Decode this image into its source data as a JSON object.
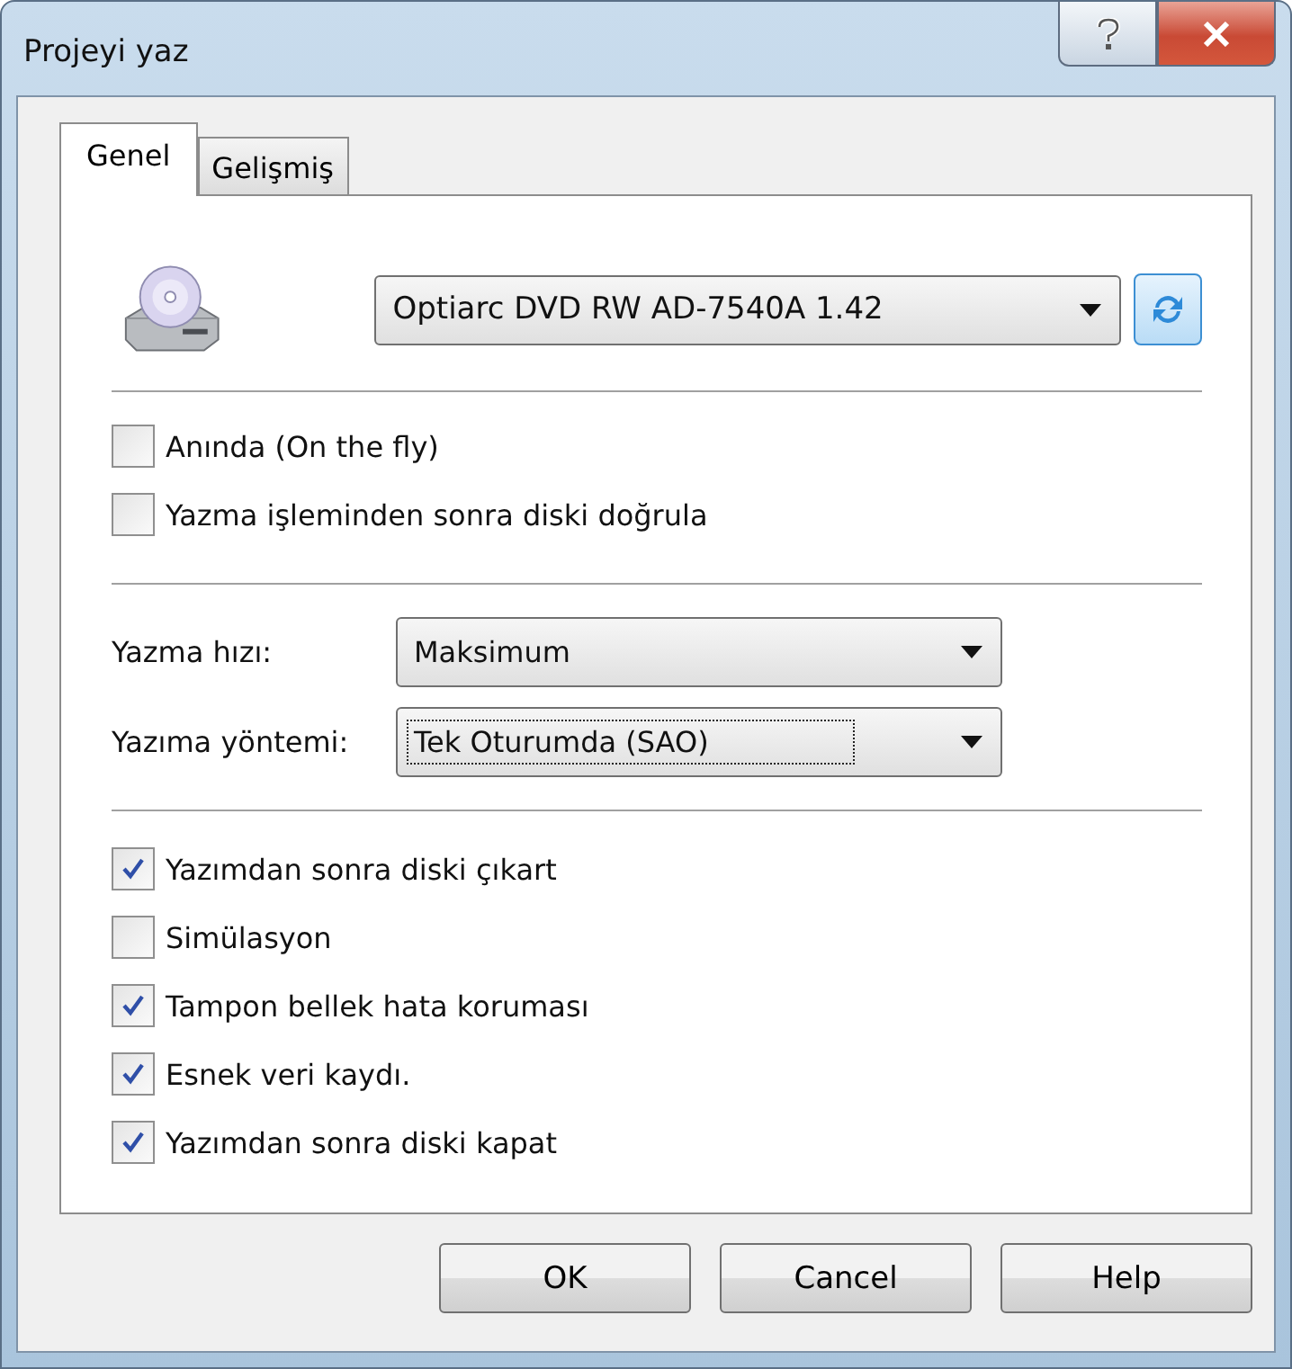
{
  "window": {
    "title": "Projeyi yaz"
  },
  "tabs": [
    {
      "label": "Genel",
      "selected": true
    },
    {
      "label": "Gelişmiş",
      "selected": false
    }
  ],
  "device": {
    "value": "Optiarc DVD RW AD-7540A 1.42"
  },
  "write_options": [
    {
      "label": "Anında (On the fly)",
      "checked": false
    },
    {
      "label": "Yazma işleminden sonra diski doğrula",
      "checked": false
    }
  ],
  "fields": [
    {
      "label": "Yazma hızı:",
      "value": "Maksimum",
      "focused": false
    },
    {
      "label": "Yazıma yöntemi:",
      "value": "Tek Oturumda (SAO)",
      "focused": true
    }
  ],
  "disc_options": [
    {
      "label": "Yazımdan sonra diski çıkart",
      "checked": true
    },
    {
      "label": "Simülasyon",
      "checked": false
    },
    {
      "label": "Tampon bellek hata koruması",
      "checked": true
    },
    {
      "label": "Esnek veri kaydı.",
      "checked": true
    },
    {
      "label": "Yazımdan sonra diski kapat",
      "checked": true
    }
  ],
  "buttons": [
    "OK",
    "Cancel",
    "Help"
  ]
}
